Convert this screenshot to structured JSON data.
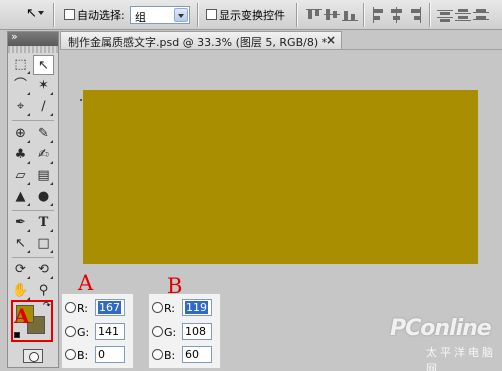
{
  "options_bar": {
    "auto_select_label": "自动选择:",
    "auto_select_value": "组",
    "transform_controls_label": "显示变换控件"
  },
  "document": {
    "tab_title": "制作金属质感文字.psd @ 33.3% (图层 5, RGB/8) *",
    "close_glyph": "×",
    "canvas_color": "#a88e00"
  },
  "tools": {
    "foreground_color": "#a78d00",
    "background_color": "#776c3c",
    "swatch_annotation": "A"
  },
  "color_panel_a": {
    "annotation": "A",
    "r_label": "R:",
    "r_value": "167",
    "g_label": "G:",
    "g_value": "141",
    "b_label": "B:",
    "b_value": "0"
  },
  "color_panel_b": {
    "annotation": "B",
    "r_label": "R:",
    "r_value": "119",
    "g_label": "G:",
    "g_value": "108",
    "b_label": "B:",
    "b_value": "60"
  },
  "watermark": {
    "brand": "PConline",
    "tagline": "太平洋电脑网"
  }
}
